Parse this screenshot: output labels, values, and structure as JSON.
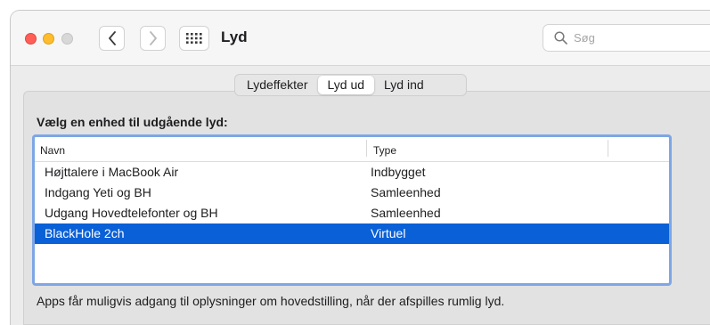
{
  "window": {
    "title": "Lyd",
    "search_placeholder": "Søg"
  },
  "tabs": [
    {
      "label": "Lydeffekter",
      "active": false
    },
    {
      "label": "Lyd ud",
      "active": true
    },
    {
      "label": "Lyd ind",
      "active": false
    }
  ],
  "output": {
    "heading": "Vælg en enhed til udgående lyd:",
    "columns": {
      "name": "Navn",
      "type": "Type"
    },
    "devices": [
      {
        "name": "Højttalere i MacBook Air",
        "type": "Indbygget",
        "selected": false
      },
      {
        "name": "Indgang Yeti og BH",
        "type": "Samleenhed",
        "selected": false
      },
      {
        "name": "Udgang Hovedtelefonter og BH",
        "type": "Samleenhed",
        "selected": false
      },
      {
        "name": "BlackHole 2ch",
        "type": "Virtuel",
        "selected": true
      }
    ]
  },
  "footer_text": "Apps får muligvis adgang til oplysninger om hovedstilling, når der afspilles rumlig lyd.",
  "colors": {
    "selection": "#0a60d6",
    "focus_ring": "#7ea6e6"
  },
  "icons": [
    "close-icon",
    "minimize-icon",
    "zoom-icon",
    "chevron-left-icon",
    "chevron-right-icon",
    "grid-icon",
    "search-icon"
  ]
}
